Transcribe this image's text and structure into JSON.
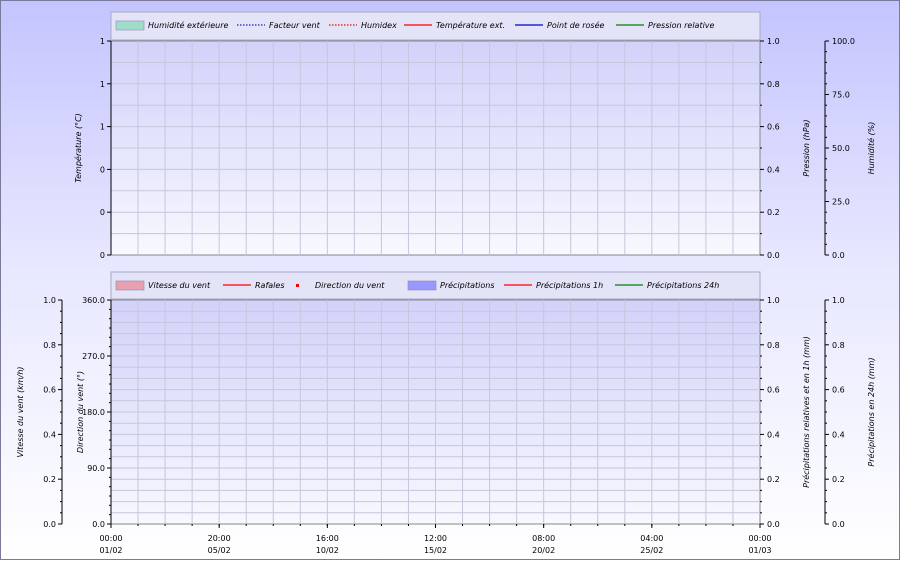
{
  "chart_data": [
    {
      "type": "line",
      "legend_placement": "top",
      "grid": true,
      "legend": [
        {
          "label": "Humidité extérieure",
          "style": "area",
          "color": "#9fdccc"
        },
        {
          "label": "Facteur vent",
          "style": "dotted",
          "color": "#2020c0"
        },
        {
          "label": "Humidex",
          "style": "dotted",
          "color": "#ff0000"
        },
        {
          "label": "Température ext.",
          "style": "line",
          "color": "#ff0000"
        },
        {
          "label": "Point de rosée",
          "style": "line",
          "color": "#0000cc"
        },
        {
          "label": "Pression relative",
          "style": "line",
          "color": "#008000"
        }
      ],
      "series": [],
      "axes": {
        "y_left": {
          "label": "Température (°C)",
          "ticks": [
            "1",
            "1",
            "1",
            "0",
            "0",
            "0"
          ]
        },
        "y_right1": {
          "label": "Pression (hPa)",
          "ticks": [
            "1.0",
            "0.8",
            "0.6",
            "0.4",
            "0.2",
            "0.0"
          ],
          "range": [
            0,
            1
          ]
        },
        "y_right2": {
          "label": "Humidité  (%)",
          "ticks": [
            "100.0",
            "75.0",
            "50.0",
            "25.0",
            "0.0"
          ],
          "range": [
            0,
            100
          ]
        }
      }
    },
    {
      "type": "line",
      "legend_placement": "top",
      "grid": true,
      "legend": [
        {
          "label": "Vitesse du vent",
          "style": "area",
          "color": "#e8a0b0"
        },
        {
          "label": "Rafales",
          "style": "line",
          "color": "#ff0000"
        },
        {
          "label": "Direction du vent",
          "style": "dots",
          "color": "#ff0000"
        },
        {
          "label": "Précipitations",
          "style": "area",
          "color": "#9898ff"
        },
        {
          "label": "Précipitations 1h",
          "style": "line",
          "color": "#ff0000"
        },
        {
          "label": "Précipitations 24h",
          "style": "line",
          "color": "#008000"
        }
      ],
      "series": [],
      "axes": {
        "y_left1": {
          "label": "Vitesse du vent (km/h)",
          "ticks": [
            "1.0",
            "0.8",
            "0.6",
            "0.4",
            "0.2",
            "0.0"
          ],
          "range": [
            0,
            1
          ]
        },
        "y_left2": {
          "label": "Direction du vent (°)",
          "ticks": [
            "360.0",
            "270.0",
            "180.0",
            "90.0",
            "0.0"
          ],
          "range": [
            0,
            360
          ]
        },
        "y_right1": {
          "label": "Précipitations relatives et en 1h (mm)",
          "ticks": [
            "1.0",
            "0.8",
            "0.6",
            "0.4",
            "0.2",
            "0.0"
          ],
          "range": [
            0,
            1
          ]
        },
        "y_right2": {
          "label": "Précipitations en 24h (mm)",
          "ticks": [
            "1.0",
            "0.8",
            "0.6",
            "0.4",
            "0.2",
            "0.0"
          ],
          "range": [
            0,
            1
          ]
        }
      },
      "x_ticks": [
        {
          "time": "00:00",
          "date": "01/02"
        },
        {
          "time": "20:00",
          "date": "05/02"
        },
        {
          "time": "16:00",
          "date": "10/02"
        },
        {
          "time": "12:00",
          "date": "15/02"
        },
        {
          "time": "08:00",
          "date": "20/02"
        },
        {
          "time": "04:00",
          "date": "25/02"
        },
        {
          "time": "00:00",
          "date": "01/03"
        }
      ]
    }
  ]
}
